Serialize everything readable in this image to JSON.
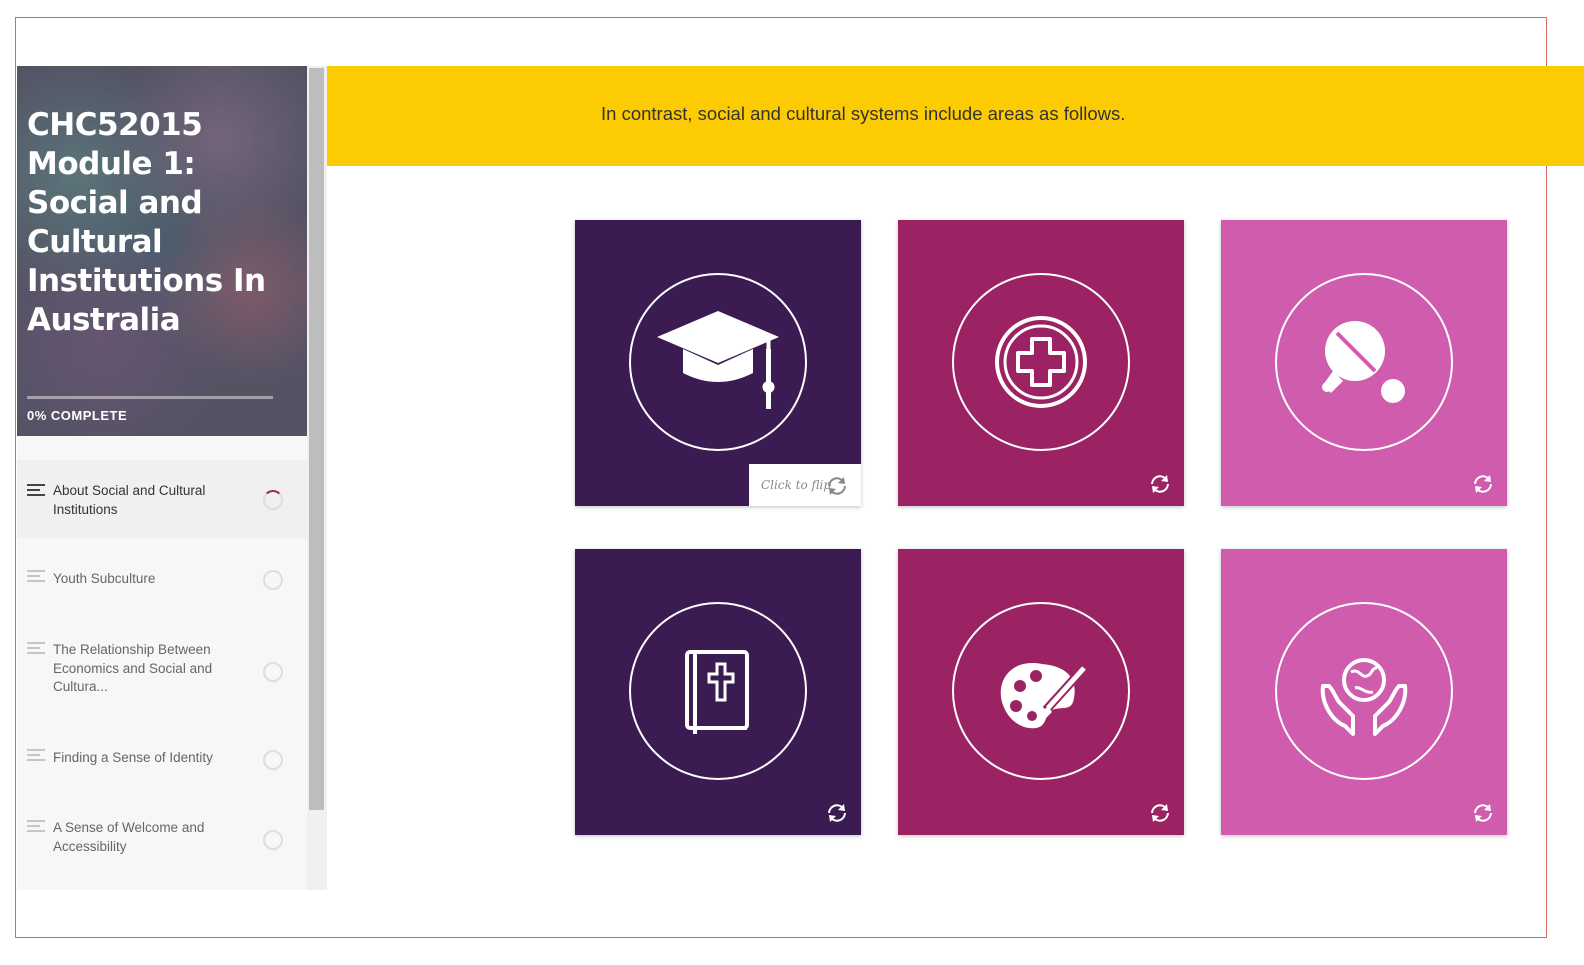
{
  "course": {
    "title": "CHC52015 Module 1: Social and Cultural Institutions In Australia",
    "progress_percent": 0,
    "progress_label": "0% COMPLETE"
  },
  "lessons": [
    {
      "label": "About Social and Cultural Institutions",
      "status": "in-progress"
    },
    {
      "label": "Youth Subculture",
      "status": "not-started"
    },
    {
      "label": "The Relationship Between Economics and Social and Cultura...",
      "status": "not-started"
    },
    {
      "label": "Finding a Sense of Identity",
      "status": "not-started"
    },
    {
      "label": "A Sense of Welcome and Accessibility",
      "status": "not-started"
    }
  ],
  "banner": {
    "text": "In contrast, social and cultural systems include areas as follows.",
    "color": "#fdcb02"
  },
  "cards": [
    {
      "icon": "graduation-cap-icon",
      "color": "#3b1c52",
      "flip_label": "Click to flip"
    },
    {
      "icon": "medical-cross-icon",
      "color": "#9b2363"
    },
    {
      "icon": "ping-pong-icon",
      "color": "#d05cae"
    },
    {
      "icon": "bible-icon",
      "color": "#3b1c52"
    },
    {
      "icon": "paint-palette-icon",
      "color": "#9b2363"
    },
    {
      "icon": "hands-globe-icon",
      "color": "#d05cae"
    }
  ]
}
